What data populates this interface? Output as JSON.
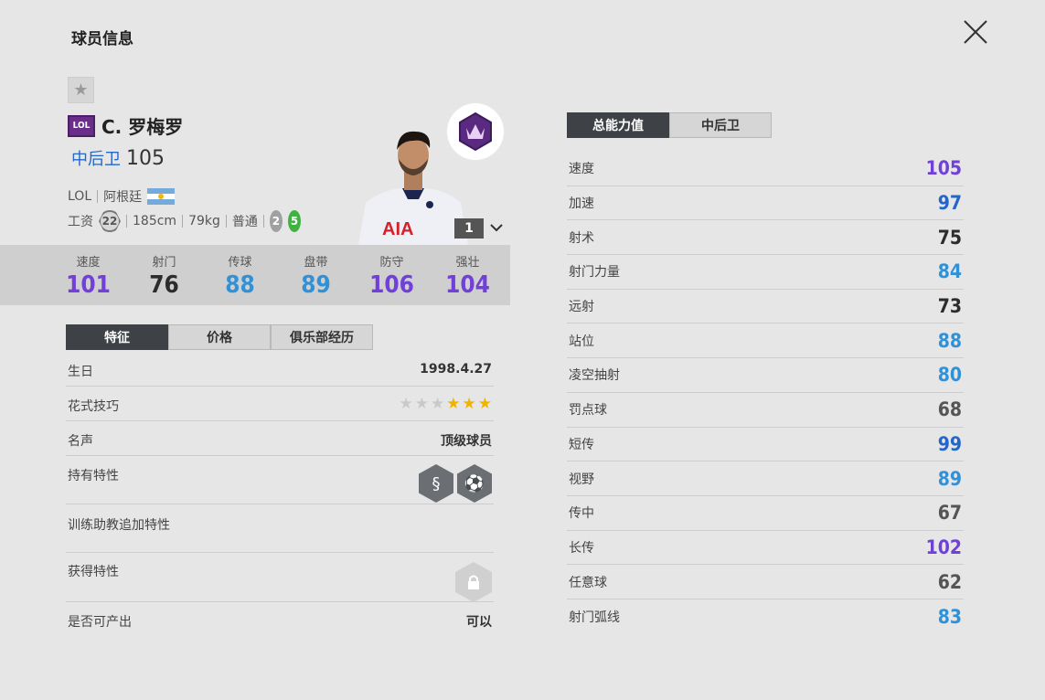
{
  "header": {
    "title": "球员信息",
    "close_icon": "close-icon"
  },
  "player": {
    "favorite_icon": "star-icon",
    "season_badge": "LOL",
    "name": "C. 罗梅罗",
    "position": "中后卫",
    "overall": "105",
    "season": "LOL",
    "nationality": "阿根廷",
    "wage_label": "工资",
    "wage": "22",
    "height": "185cm",
    "weight": "79kg",
    "body_type": "普通",
    "weak_foot_left": "2",
    "weak_foot_right": "5",
    "level": "1",
    "colors": {
      "accent_purple": "#6a3fd1",
      "accent_blue": "#2f8fd8",
      "dark": "#2c2c2c",
      "badge_purple": "#6b2d8a"
    }
  },
  "summary_stats": [
    {
      "label": "速度",
      "value": "101",
      "color": "#7040d8"
    },
    {
      "label": "射门",
      "value": "76",
      "color": "#2c2c2c"
    },
    {
      "label": "传球",
      "value": "88",
      "color": "#3191d6"
    },
    {
      "label": "盘带",
      "value": "89",
      "color": "#3191d6"
    },
    {
      "label": "防守",
      "value": "106",
      "color": "#7040d8"
    },
    {
      "label": "强壮",
      "value": "104",
      "color": "#7040d8"
    }
  ],
  "left_tabs": [
    {
      "label": "特征",
      "active": true
    },
    {
      "label": "价格",
      "active": false
    },
    {
      "label": "俱乐部经历",
      "active": false
    }
  ],
  "info": {
    "birthday_label": "生日",
    "birthday": "1998.4.27",
    "skill_label": "花式技巧",
    "skill_stars": 3,
    "skill_max": 6,
    "reputation_label": "名声",
    "reputation": "顶级球员",
    "traits_label": "持有特性",
    "traits_icons": [
      "snake-dribble-icon",
      "long-ball-icon"
    ],
    "coach_label": "训练助教追加特性",
    "acquired_label": "获得特性",
    "acquired_icon": "lock-icon",
    "producible_label": "是否可产出",
    "producible": "可以"
  },
  "right_tabs": [
    {
      "label": "总能力值",
      "active": true
    },
    {
      "label": "中后卫",
      "active": false
    }
  ],
  "attributes": [
    {
      "label": "速度",
      "value": "105",
      "color": "#7040d8"
    },
    {
      "label": "加速",
      "value": "97",
      "color": "#2466c9"
    },
    {
      "label": "射术",
      "value": "75",
      "color": "#2c2c2c"
    },
    {
      "label": "射门力量",
      "value": "84",
      "color": "#3191d6"
    },
    {
      "label": "远射",
      "value": "73",
      "color": "#2c2c2c"
    },
    {
      "label": "站位",
      "value": "88",
      "color": "#3191d6"
    },
    {
      "label": "凌空抽射",
      "value": "80",
      "color": "#3191d6"
    },
    {
      "label": "罚点球",
      "value": "68",
      "color": "#555555"
    },
    {
      "label": "短传",
      "value": "99",
      "color": "#2466c9"
    },
    {
      "label": "视野",
      "value": "89",
      "color": "#3191d6"
    },
    {
      "label": "传中",
      "value": "67",
      "color": "#555555"
    },
    {
      "label": "长传",
      "value": "102",
      "color": "#7040d8"
    },
    {
      "label": "任意球",
      "value": "62",
      "color": "#555555"
    },
    {
      "label": "射门弧线",
      "value": "83",
      "color": "#3191d6"
    }
  ]
}
